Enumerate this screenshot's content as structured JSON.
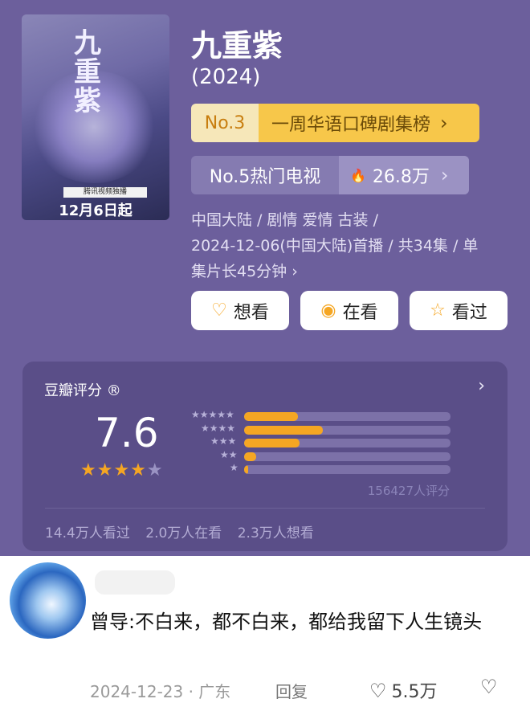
{
  "poster": {
    "title_art": "九重紫",
    "strip_text": "腾讯视频独播",
    "date_text": "12月6日起"
  },
  "show": {
    "title": "九重紫",
    "year": "(2024)"
  },
  "rank": {
    "number": "No.3",
    "list": "一周华语口碑剧集榜",
    "chevron": "›"
  },
  "hot": {
    "label": "No.5热门电视",
    "flame": "🔥",
    "count": "26.8万",
    "chevron": "›"
  },
  "meta": {
    "line1": "中国大陆 / 剧情 爱情 古装 /",
    "line2": "2024-12-06(中国大陆)首播 / 共34集 / 单",
    "line3": "集片长45分钟 ›"
  },
  "buttons": {
    "want": {
      "icon": "♡",
      "label": "想看"
    },
    "watching": {
      "icon": "◉",
      "label": "在看"
    },
    "watched": {
      "icon": "☆",
      "label": "看过"
    }
  },
  "rating": {
    "label": "豆瓣评分 ®",
    "arrow": "›",
    "score": "7.6",
    "stars_on": "★★★★",
    "stars_off": "★",
    "distribution": [
      {
        "stars": "★★★★★",
        "fraction": 0.26
      },
      {
        "stars": "★★★★",
        "fraction": 0.38
      },
      {
        "stars": "★★★",
        "fraction": 0.27
      },
      {
        "stars": "★★",
        "fraction": 0.06
      },
      {
        "stars": "★",
        "fraction": 0.02
      }
    ],
    "votes": "156427人评分",
    "watched": "14.4万人看过",
    "watching": "2.0万人在看",
    "want": "2.3万人想看"
  },
  "comment": {
    "text": "曾导:不白来，都不白来，都给我留下人生镜头",
    "date": "2024-12-23 · 广东",
    "reply_label": "回复",
    "like_icon": "♡",
    "likes": "5.5万",
    "dislike_icon": "♡"
  }
}
